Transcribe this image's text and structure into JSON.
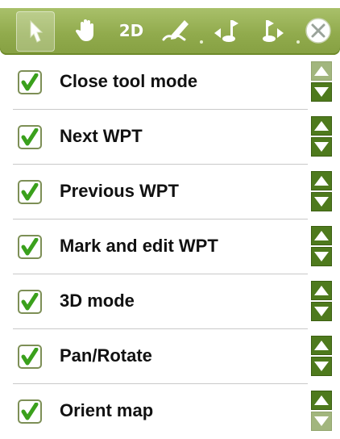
{
  "toolbar": {
    "buttons": [
      {
        "name": "select-arrow-icon",
        "active": true
      },
      {
        "name": "hand-pan-icon",
        "active": false
      },
      {
        "name": "2d-mode",
        "label": "2D",
        "active": false
      },
      {
        "name": "pen-draw-icon",
        "active": false
      },
      {
        "name": "flag-left-icon",
        "active": false
      },
      {
        "name": "flag-right-icon",
        "active": false
      },
      {
        "name": "close-icon",
        "active": false
      }
    ],
    "mode_2d_label": "2D",
    "accent_color": "#91ab4d"
  },
  "items": [
    {
      "label": "Close tool mode",
      "checked": true,
      "up_enabled": false,
      "down_enabled": true
    },
    {
      "label": "Next WPT",
      "checked": true,
      "up_enabled": true,
      "down_enabled": true
    },
    {
      "label": "Previous WPT",
      "checked": true,
      "up_enabled": true,
      "down_enabled": true
    },
    {
      "label": "Mark and edit WPT",
      "checked": true,
      "up_enabled": true,
      "down_enabled": true
    },
    {
      "label": "3D mode",
      "checked": true,
      "up_enabled": true,
      "down_enabled": true
    },
    {
      "label": "Pan/Rotate",
      "checked": true,
      "up_enabled": true,
      "down_enabled": true
    },
    {
      "label": "Orient map",
      "checked": true,
      "up_enabled": true,
      "down_enabled": false
    }
  ],
  "colors": {
    "check_green": "#3aa01c",
    "arrow_enabled": "#4e7a1d",
    "arrow_disabled": "#a2b67e"
  }
}
